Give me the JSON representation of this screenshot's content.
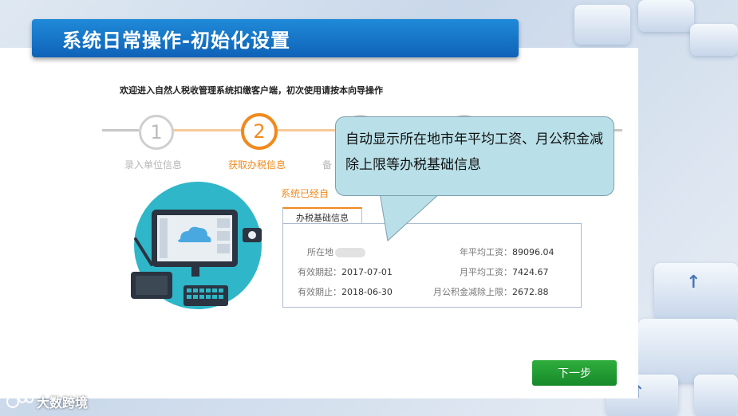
{
  "header": {
    "title": "系统日常操作-初始化设置"
  },
  "welcome_text": "欢迎进入自然人税收管理系统扣缴客户端，初次使用请按本向导操作",
  "steps": [
    {
      "number": "1",
      "label": "录入单位信息",
      "state": "done"
    },
    {
      "number": "2",
      "label": "获取办税信息",
      "state": "active"
    },
    {
      "label": "备"
    }
  ],
  "status_text": "系统已经自",
  "callout_text": "自动显示所在地市年平均工资、月公积金减除上限等办税基础信息",
  "info_box": {
    "tab_label": "办税基础信息",
    "rows": {
      "location_label": "所在地",
      "valid_from_label": "有效期起：",
      "valid_from_value": "2017-07-01",
      "valid_to_label": "有效期止：",
      "valid_to_value": "2018-06-30",
      "annual_avg_wage_label": "年平均工资：",
      "annual_avg_wage_value": "89096.04",
      "monthly_avg_wage_label": "月平均工资：",
      "monthly_avg_wage_value": "7424.67",
      "housing_fund_limit_label": "月公积金减除上限：",
      "housing_fund_limit_value": "2672.88"
    }
  },
  "next_button": {
    "label": "下一步"
  },
  "watermark": {
    "text": "大数跨境"
  },
  "colors": {
    "accent_orange": "#f08a1e",
    "title_blue": "#1478c8",
    "button_green": "#1f9a33",
    "callout_bg": "#b9e0e8"
  }
}
